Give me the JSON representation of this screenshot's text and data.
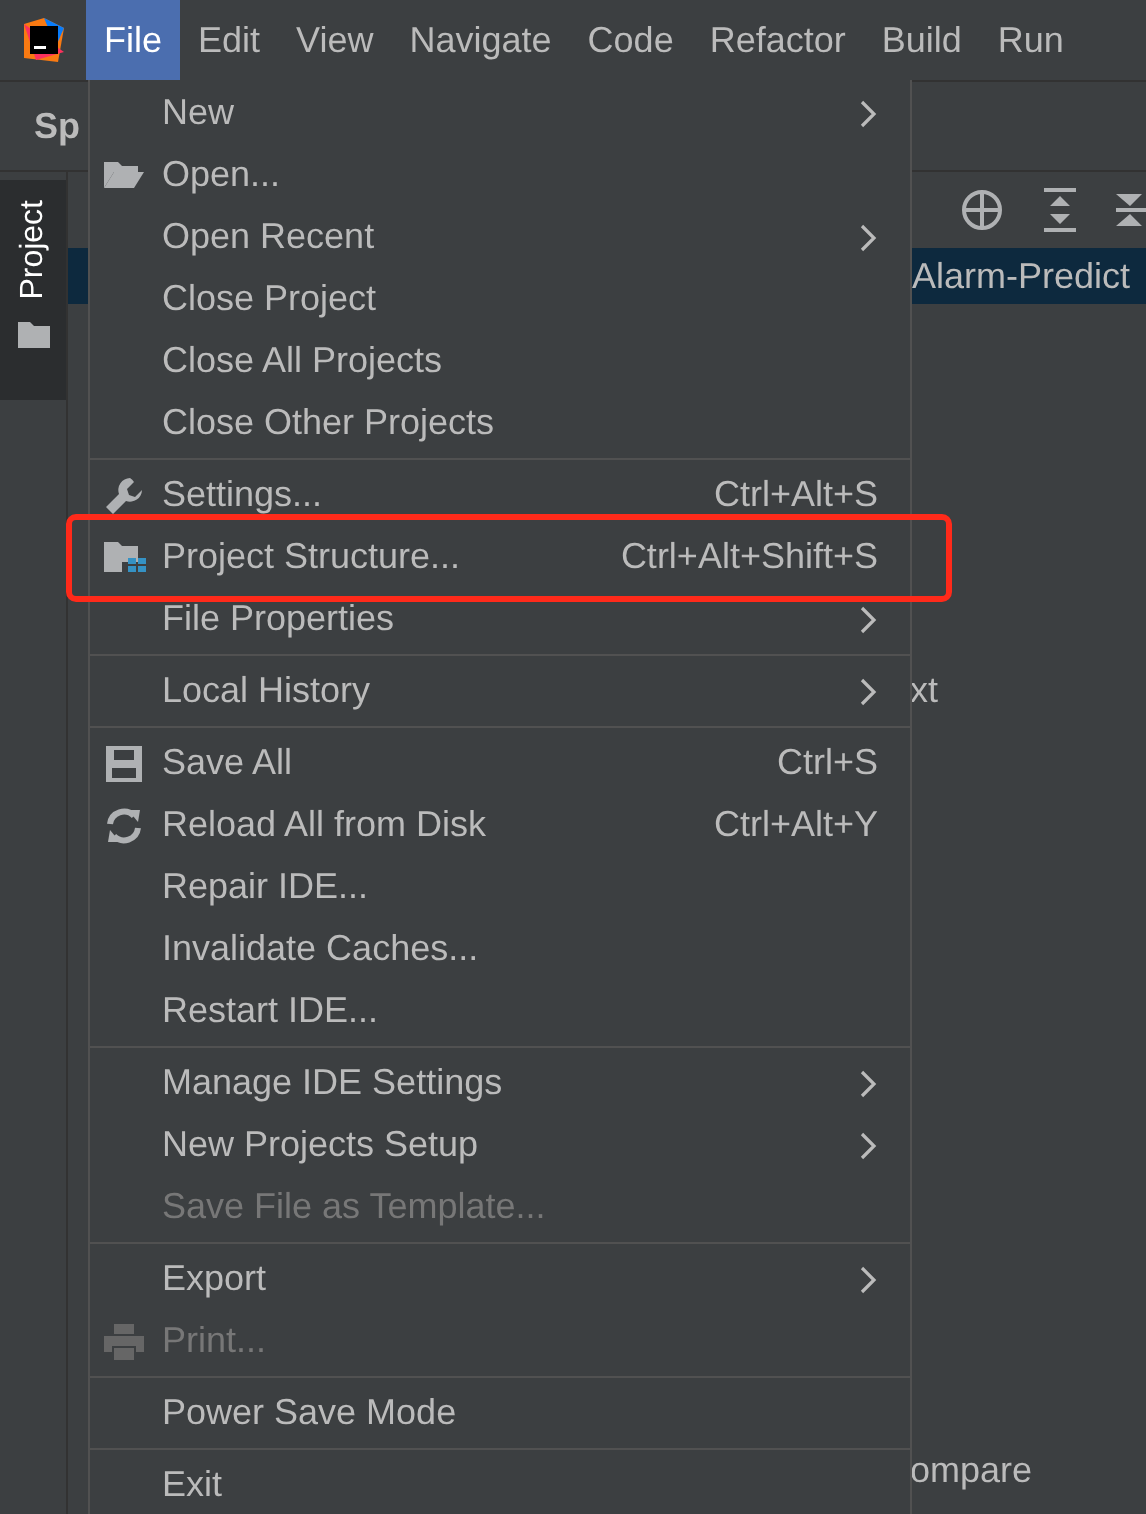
{
  "menubar": [
    {
      "label": "File",
      "selected": true
    },
    {
      "label": "Edit",
      "selected": false
    },
    {
      "label": "View",
      "selected": false
    },
    {
      "label": "Navigate",
      "selected": false
    },
    {
      "label": "Code",
      "selected": false
    },
    {
      "label": "Refactor",
      "selected": false
    },
    {
      "label": "Build",
      "selected": false
    },
    {
      "label": "Run",
      "selected": false
    }
  ],
  "navbar": {
    "text": "Sp"
  },
  "tool_window_tabs": [
    {
      "label": "Project",
      "selected": true
    }
  ],
  "project_panel": {
    "selected_row": "Alarm-Predict",
    "lines": [
      "xt",
      "ompare"
    ]
  },
  "file_menu": [
    {
      "kind": "item",
      "label": "New",
      "submenu": true,
      "disabled": false
    },
    {
      "kind": "item",
      "label": "Open...",
      "disabled": false
    },
    {
      "kind": "item",
      "label": "Open Recent",
      "submenu": true,
      "disabled": false
    },
    {
      "kind": "item",
      "label": "Close Project",
      "disabled": false
    },
    {
      "kind": "item",
      "label": "Close All Projects",
      "disabled": false
    },
    {
      "kind": "item",
      "label": "Close Other Projects",
      "disabled": false
    },
    {
      "kind": "separator"
    },
    {
      "kind": "item",
      "label": "Settings...",
      "shortcut": "Ctrl+Alt+S",
      "disabled": false
    },
    {
      "kind": "item",
      "label": "Project Structure...",
      "shortcut": "Ctrl+Alt+Shift+S",
      "disabled": false,
      "highlighted": true
    },
    {
      "kind": "item",
      "label": "File Properties",
      "submenu": true,
      "disabled": false
    },
    {
      "kind": "separator"
    },
    {
      "kind": "item",
      "label": "Local History",
      "submenu": true,
      "disabled": false
    },
    {
      "kind": "separator"
    },
    {
      "kind": "item",
      "label": "Save All",
      "shortcut": "Ctrl+S",
      "disabled": false
    },
    {
      "kind": "item",
      "label": "Reload All from Disk",
      "shortcut": "Ctrl+Alt+Y",
      "disabled": false
    },
    {
      "kind": "item",
      "label": "Repair IDE...",
      "disabled": false
    },
    {
      "kind": "item",
      "label": "Invalidate Caches...",
      "disabled": false
    },
    {
      "kind": "item",
      "label": "Restart IDE...",
      "disabled": false
    },
    {
      "kind": "separator"
    },
    {
      "kind": "item",
      "label": "Manage IDE Settings",
      "submenu": true,
      "disabled": false
    },
    {
      "kind": "item",
      "label": "New Projects Setup",
      "submenu": true,
      "disabled": false
    },
    {
      "kind": "item",
      "label": "Save File as Template...",
      "disabled": true
    },
    {
      "kind": "separator"
    },
    {
      "kind": "item",
      "label": "Export",
      "submenu": true,
      "disabled": false
    },
    {
      "kind": "item",
      "label": "Print...",
      "disabled": true
    },
    {
      "kind": "separator"
    },
    {
      "kind": "item",
      "label": "Power Save Mode",
      "disabled": false
    },
    {
      "kind": "separator"
    },
    {
      "kind": "item",
      "label": "Exit",
      "disabled": false
    }
  ]
}
